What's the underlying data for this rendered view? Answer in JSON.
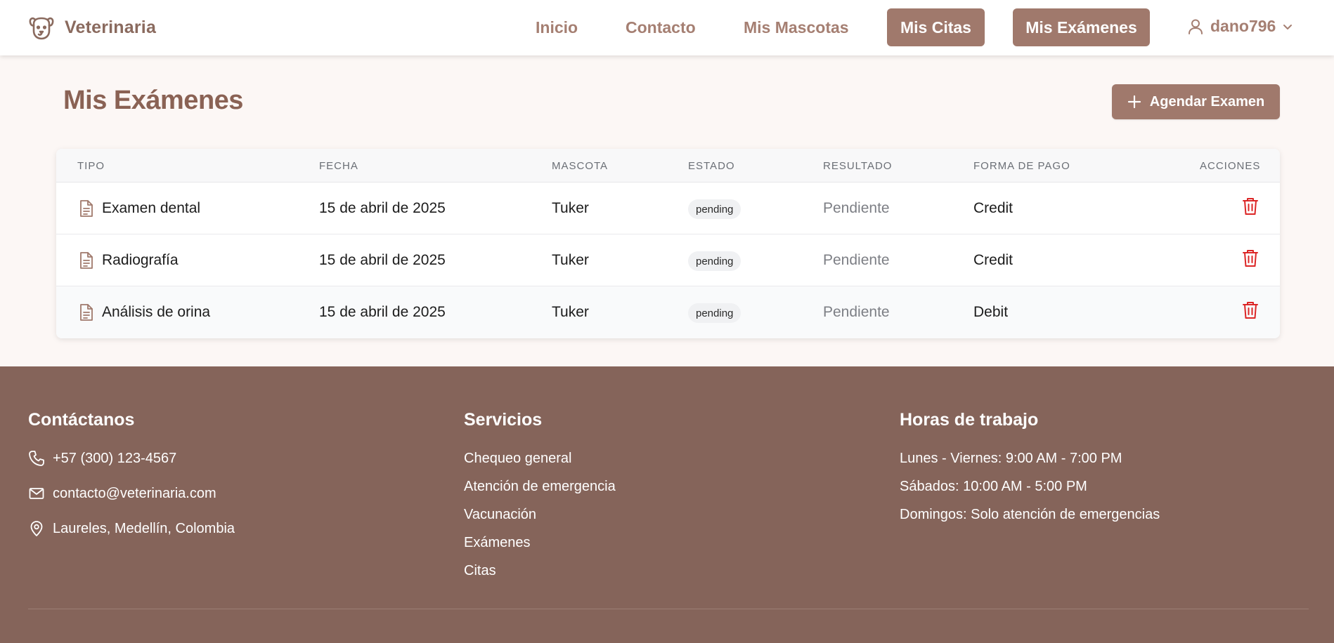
{
  "header": {
    "brand": "Veterinaria",
    "nav": {
      "inicio": "Inicio",
      "contacto": "Contacto",
      "mascotas": "Mis Mascotas",
      "citas": "Mis Citas",
      "examenes": "Mis Exámenes"
    },
    "user": "dano796"
  },
  "page": {
    "title": "Mis Exámenes",
    "add_button": "Agendar Examen"
  },
  "table": {
    "columns": [
      "TIPO",
      "FECHA",
      "MASCOTA",
      "ESTADO",
      "RESULTADO",
      "FORMA DE PAGO",
      "ACCIONES"
    ],
    "rows": [
      {
        "tipo": "Examen dental",
        "fecha": "15 de abril de 2025",
        "mascota": "Tuker",
        "estado": "pending",
        "resultado": "Pendiente",
        "pago": "Credit"
      },
      {
        "tipo": "Radiografía",
        "fecha": "15 de abril de 2025",
        "mascota": "Tuker",
        "estado": "pending",
        "resultado": "Pendiente",
        "pago": "Credit"
      },
      {
        "tipo": "Análisis de orina",
        "fecha": "15 de abril de 2025",
        "mascota": "Tuker",
        "estado": "pending",
        "resultado": "Pendiente",
        "pago": "Debit"
      }
    ]
  },
  "footer": {
    "contact": {
      "title": "Contáctanos",
      "phone": "+57 (300) 123-4567",
      "email": "contacto@veterinaria.com",
      "address": "Laureles, Medellín, Colombia"
    },
    "services": {
      "title": "Servicios",
      "items": [
        "Chequeo general",
        "Atención de emergencia",
        "Vacunación",
        "Exámenes",
        "Citas"
      ]
    },
    "hours": {
      "title": "Horas de trabajo",
      "items": [
        "Lunes - Viernes: 9:00 AM - 7:00 PM",
        "Sábados: 10:00 AM - 5:00 PM",
        "Domingos: Solo atención de emergencias"
      ]
    }
  },
  "icons": {
    "brand": "dog-icon",
    "user": "user-icon",
    "chevron": "chevron-down-icon",
    "add": "plus-icon",
    "row": "document-icon",
    "delete": "trash-icon",
    "phone": "phone-icon",
    "email": "mail-icon",
    "address": "map-pin-icon"
  },
  "colors": {
    "brand": "#8a6a5e",
    "accent": "#a0796c",
    "footer_bg": "#85645a",
    "delete": "#dc2626",
    "page_bg": "#fcf7f5"
  }
}
